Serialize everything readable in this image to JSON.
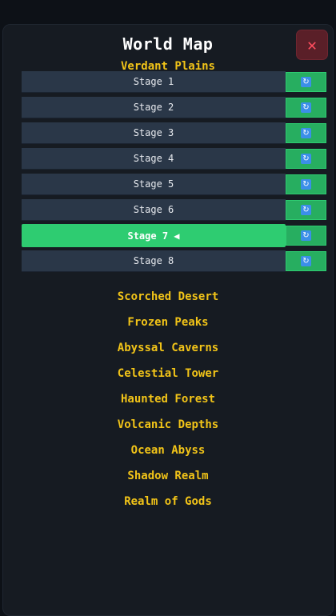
{
  "header": {
    "title": "World Map",
    "close_glyph": "✕"
  },
  "worlds": [
    {
      "name": "Verdant Plains",
      "expanded": true,
      "stages": [
        {
          "label": "Stage 1",
          "current": false
        },
        {
          "label": "Stage 2",
          "current": false
        },
        {
          "label": "Stage 3",
          "current": false
        },
        {
          "label": "Stage 4",
          "current": false
        },
        {
          "label": "Stage 5",
          "current": false
        },
        {
          "label": "Stage 6",
          "current": false
        },
        {
          "label": "Stage 7 ◀",
          "current": true
        },
        {
          "label": "Stage 8",
          "current": false
        }
      ]
    },
    {
      "name": "Scorched Desert",
      "expanded": false
    },
    {
      "name": "Frozen Peaks",
      "expanded": false
    },
    {
      "name": "Abyssal Caverns",
      "expanded": false
    },
    {
      "name": "Celestial Tower",
      "expanded": false
    },
    {
      "name": "Haunted Forest",
      "expanded": false
    },
    {
      "name": "Volcanic Depths",
      "expanded": false
    },
    {
      "name": "Ocean Abyss",
      "expanded": false
    },
    {
      "name": "Shadow Realm",
      "expanded": false
    },
    {
      "name": "Realm of Gods",
      "expanded": false
    }
  ],
  "icons": {
    "replay": "replay-icon",
    "close": "close-icon"
  },
  "colors": {
    "world_title": "#f2c418",
    "current_stage": "#2ecc71",
    "replay_button": "#27ae60",
    "stage_button": "#2a3748",
    "close_button": "#5a1f28"
  }
}
